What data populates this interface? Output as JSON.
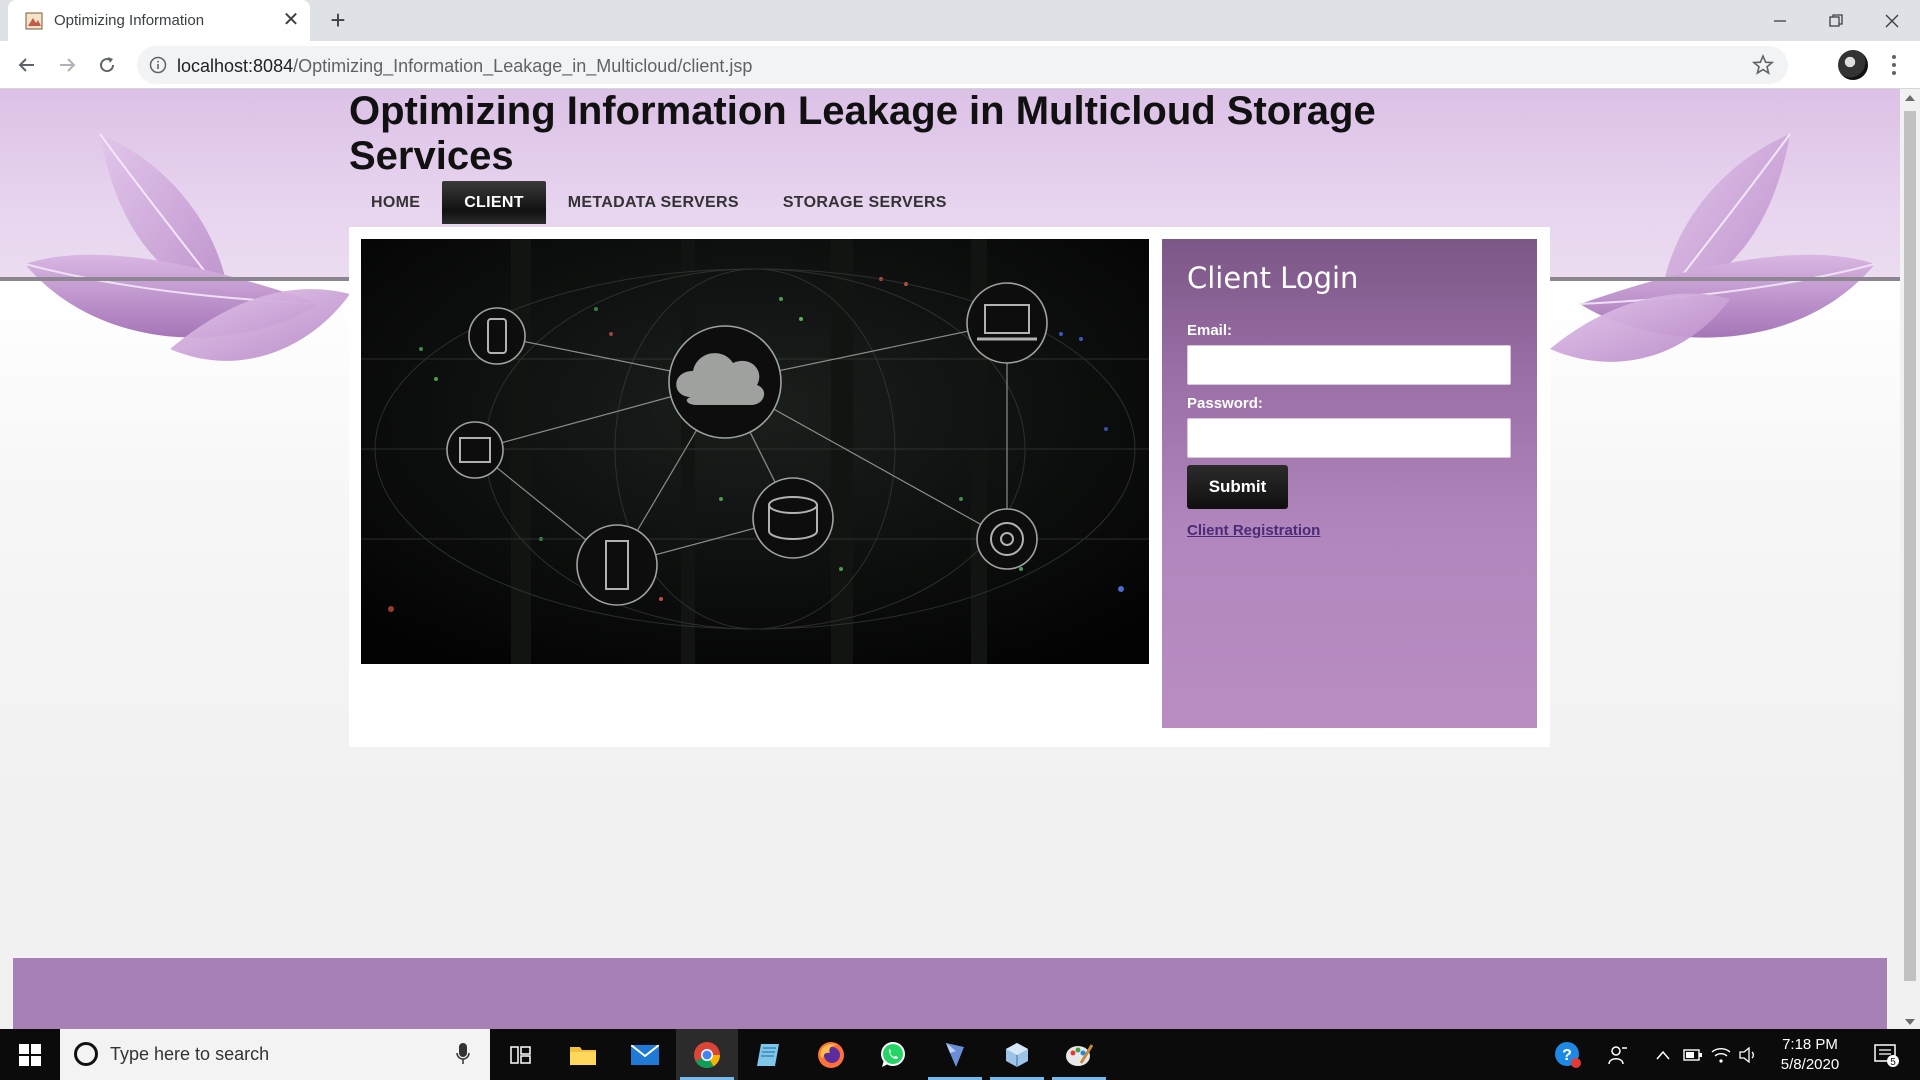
{
  "browser": {
    "tab_title": "Optimizing Information",
    "url_host": "localhost:8084",
    "url_path": "/Optimizing_Information_Leakage_in_Multicloud/client.jsp"
  },
  "site": {
    "title": "Optimizing Information Leakage in Multicloud Storage Services",
    "nav": [
      {
        "label": "HOME",
        "active": false
      },
      {
        "label": "CLIENT",
        "active": true
      },
      {
        "label": "METADATA SERVERS",
        "active": false
      },
      {
        "label": "STORAGE SERVERS",
        "active": false
      }
    ]
  },
  "login": {
    "title": "Client Login",
    "email_label": "Email:",
    "email_value": "",
    "password_label": "Password:",
    "password_value": "",
    "submit_label": "Submit",
    "registration_link": "Client Registration"
  },
  "taskbar": {
    "search_placeholder": "Type here to search",
    "time": "7:18 PM",
    "date": "5/8/2020",
    "notification_count": "5",
    "pinned": [
      "task-view",
      "file-explorer",
      "mail",
      "chrome",
      "notepad",
      "firefox",
      "whatsapp",
      "netbeans",
      "virtualbox",
      "paint"
    ]
  },
  "colors": {
    "header_band": "#dcc1e6",
    "login_panel_top": "#7b5786",
    "login_panel_bottom": "#b98dc2",
    "footer": "#a780b6",
    "link": "#4b2a78"
  }
}
